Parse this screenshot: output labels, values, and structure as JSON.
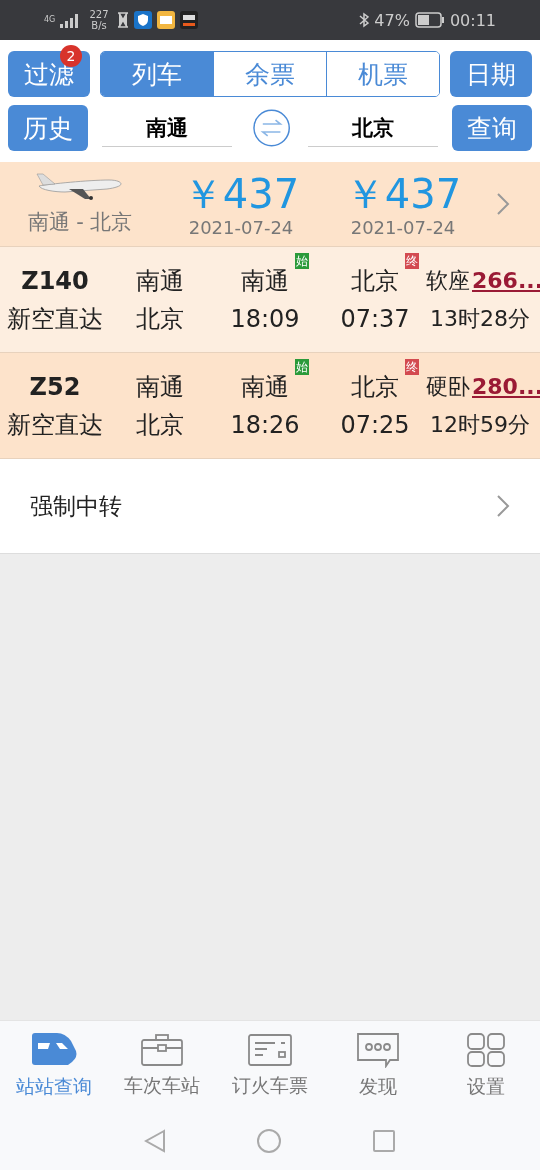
{
  "status_bar": {
    "network": "4G",
    "speed": "227 B/s",
    "battery": "47%",
    "time": "00:11"
  },
  "filter_button": {
    "label": "过滤",
    "badge": "2"
  },
  "tabs": [
    {
      "label": "列车",
      "selected": true
    },
    {
      "label": "余票",
      "selected": false
    },
    {
      "label": "机票",
      "selected": false
    }
  ],
  "date_button": {
    "label": "日期"
  },
  "history_button": {
    "label": "历史"
  },
  "from_station": {
    "value": "南通"
  },
  "to_station": {
    "value": "北京"
  },
  "search_button": {
    "label": "查询"
  },
  "flight": {
    "route": "南通 - 北京",
    "fares": [
      {
        "price": "￥437",
        "date": "2021-07-24"
      },
      {
        "price": "￥437",
        "date": "2021-07-24"
      }
    ]
  },
  "trains": [
    {
      "number": "Z140",
      "type": "新空直达",
      "from": "南通",
      "to": "北京",
      "depart_station": "南通",
      "start_badge": "始",
      "depart_time": "18:09",
      "arrive_station": "北京",
      "end_badge": "终",
      "arrive_time": "07:37",
      "seat": "软座",
      "price": "266...",
      "duration": "13时28分"
    },
    {
      "number": "Z52",
      "type": "新空直达",
      "from": "南通",
      "to": "北京",
      "depart_station": "南通",
      "start_badge": "始",
      "depart_time": "18:26",
      "arrive_station": "北京",
      "end_badge": "终",
      "arrive_time": "07:25",
      "seat": "硬卧",
      "price": "280...",
      "duration": "12时59分"
    }
  ],
  "transfer_row": {
    "label": "强制中转"
  },
  "bottom_tabs": [
    {
      "label": "站站查询",
      "selected": true
    },
    {
      "label": "车次车站",
      "selected": false
    },
    {
      "label": "订火车票",
      "selected": false
    },
    {
      "label": "发现",
      "selected": false
    },
    {
      "label": "设置",
      "selected": false
    }
  ]
}
